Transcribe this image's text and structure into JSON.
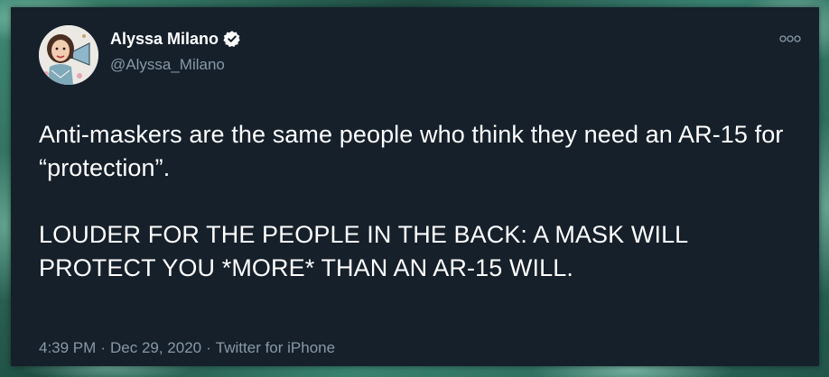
{
  "user": {
    "display_name": "Alyssa Milano",
    "handle": "@Alyssa_Milano",
    "verified": true
  },
  "tweet": {
    "text": "Anti-maskers are the same people who think they need an AR-15 for “protection”.\n\nLOUDER FOR THE PEOPLE IN THE BACK: A MASK WILL PROTECT YOU *MORE* THAN AN AR-15 WILL.",
    "time": "4:39 PM",
    "separator_1": "·",
    "date": "Dec 29, 2020",
    "separator_2": "·",
    "source": "Twitter for iPhone"
  },
  "icons": {
    "verified": "verified-badge-icon",
    "more": "more-options-icon",
    "avatar": "avatar"
  },
  "colors": {
    "card_background": "#15202b",
    "primary_text": "#ffffff",
    "secondary_text": "#8899a6"
  }
}
